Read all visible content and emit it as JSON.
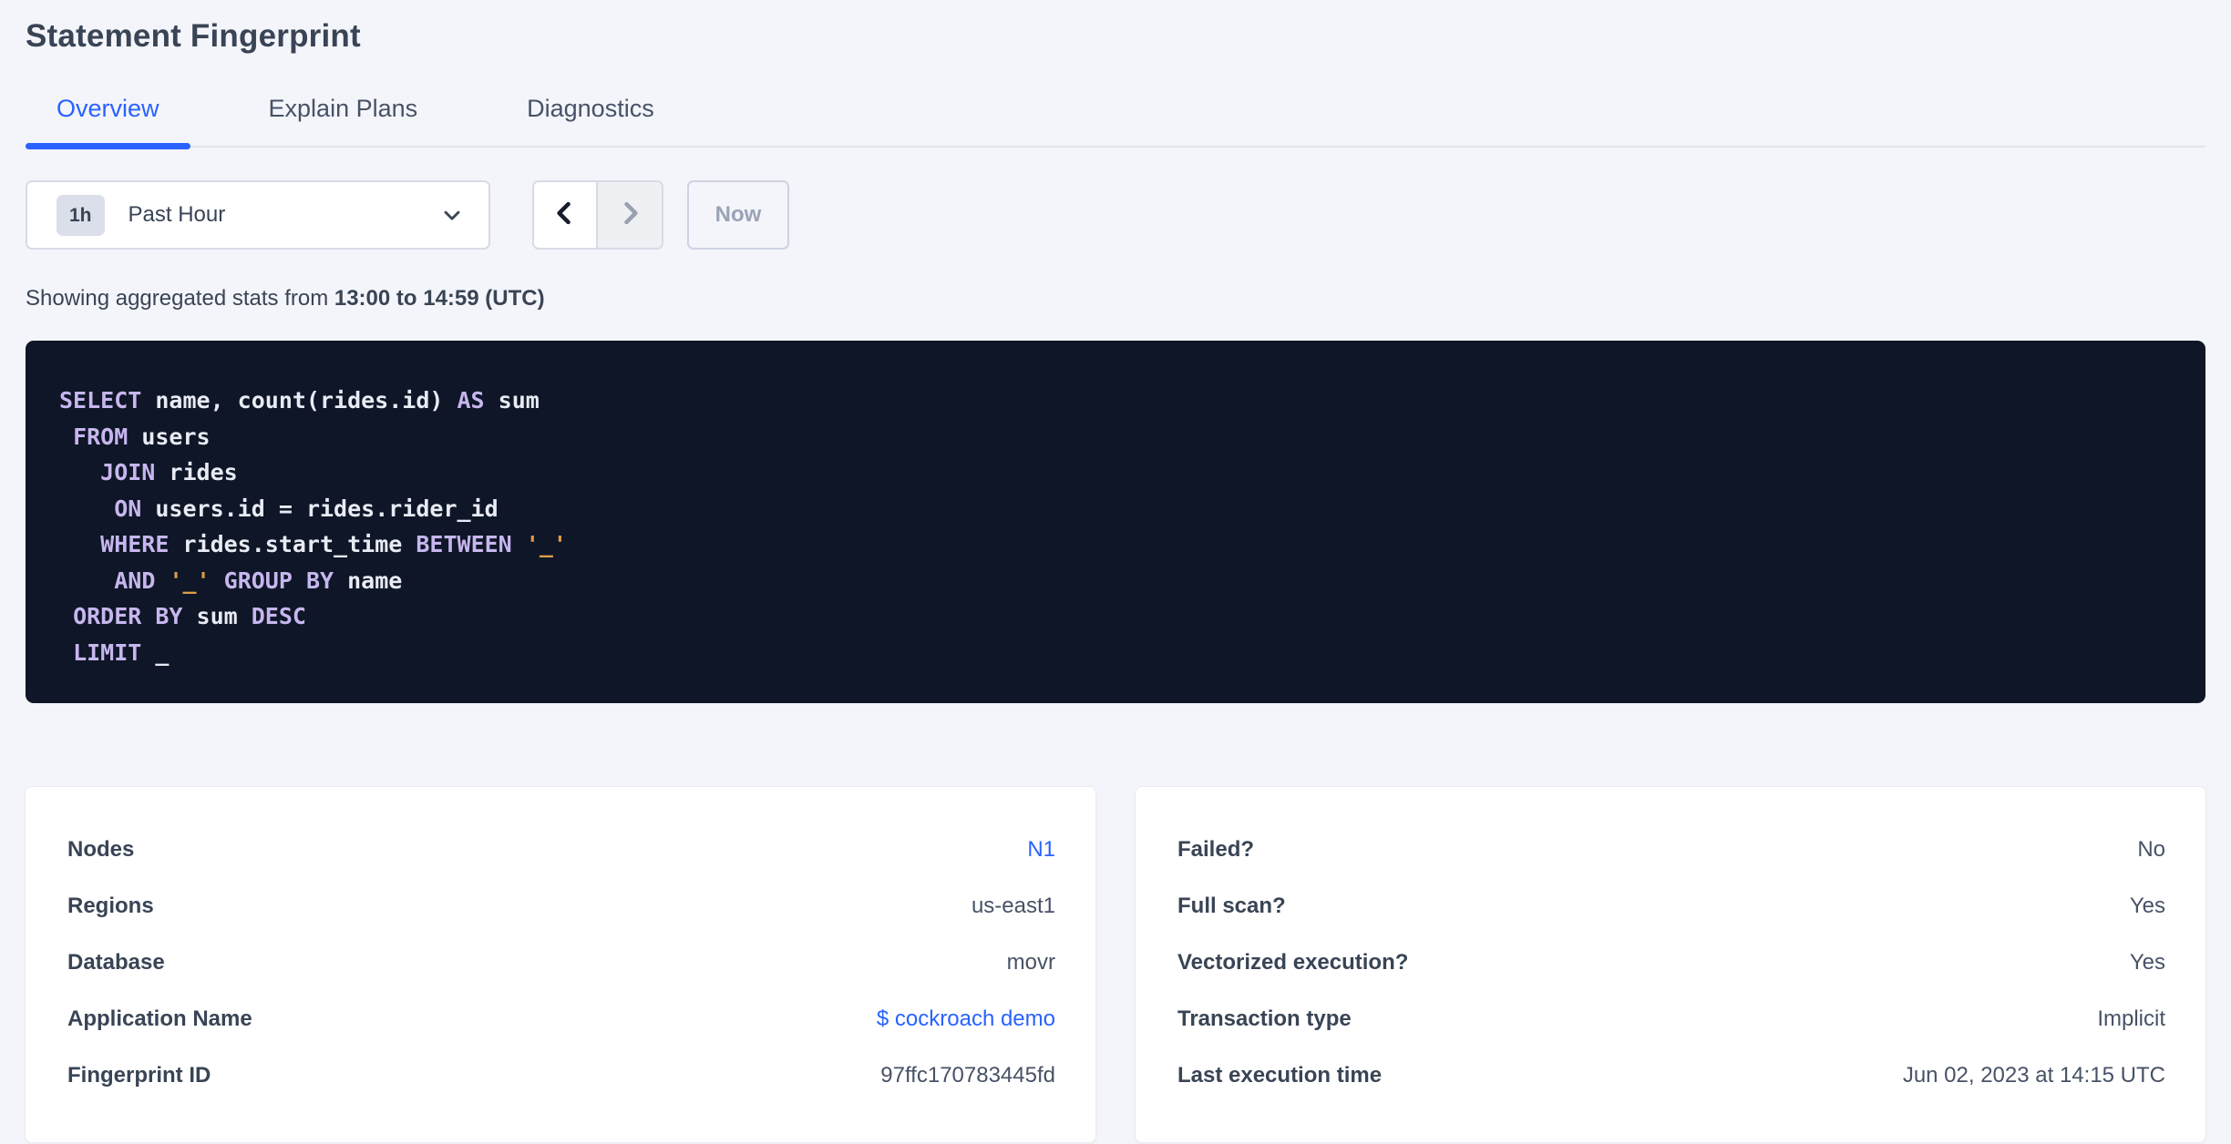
{
  "title": "Statement Fingerprint",
  "tabs": [
    {
      "label": "Overview",
      "active": true
    },
    {
      "label": "Explain Plans",
      "active": false
    },
    {
      "label": "Diagnostics",
      "active": false
    }
  ],
  "time_picker": {
    "badge": "1h",
    "selected": "Past Hour",
    "now_label": "Now",
    "icons": [
      "chevron-down-icon",
      "chevron-left-icon",
      "chevron-right-icon"
    ]
  },
  "stats_line": {
    "prefix": "Showing aggregated stats from ",
    "range": "13:00 to 14:59 (UTC)"
  },
  "sql": {
    "lines": [
      [
        [
          "kw",
          "SELECT"
        ],
        [
          "id",
          " name, count(rides.id) "
        ],
        [
          "kw",
          "AS"
        ],
        [
          "id",
          " sum"
        ]
      ],
      [
        [
          "id",
          " "
        ],
        [
          "kw",
          "FROM"
        ],
        [
          "id",
          " users"
        ]
      ],
      [
        [
          "id",
          "   "
        ],
        [
          "kw",
          "JOIN"
        ],
        [
          "id",
          " rides"
        ]
      ],
      [
        [
          "id",
          "    "
        ],
        [
          "kw",
          "ON"
        ],
        [
          "id",
          " users.id = rides.rider_id"
        ]
      ],
      [
        [
          "id",
          "   "
        ],
        [
          "kw",
          "WHERE"
        ],
        [
          "id",
          " rides.start_time "
        ],
        [
          "kw",
          "BETWEEN"
        ],
        [
          "id",
          " "
        ],
        [
          "str",
          "'_'"
        ]
      ],
      [
        [
          "id",
          "    "
        ],
        [
          "kw",
          "AND"
        ],
        [
          "id",
          " "
        ],
        [
          "str",
          "'_'"
        ],
        [
          "id",
          " "
        ],
        [
          "kw",
          "GROUP BY"
        ],
        [
          "id",
          " name"
        ]
      ],
      [
        [
          "id",
          " "
        ],
        [
          "kw",
          "ORDER BY"
        ],
        [
          "id",
          " sum "
        ],
        [
          "kw",
          "DESC"
        ]
      ],
      [
        [
          "id",
          " "
        ],
        [
          "kw",
          "LIMIT"
        ],
        [
          "id",
          " _"
        ]
      ]
    ]
  },
  "info_cards": [
    {
      "side": "left",
      "rows": [
        {
          "label": "Nodes",
          "value": "N1",
          "link": true
        },
        {
          "label": "Regions",
          "value": "us-east1",
          "link": false
        },
        {
          "label": "Database",
          "value": "movr",
          "link": false
        },
        {
          "label": "Application Name",
          "value": "$ cockroach demo",
          "link": true
        },
        {
          "label": "Fingerprint ID",
          "value": "97ffc170783445fd",
          "link": false
        }
      ]
    },
    {
      "side": "right",
      "rows": [
        {
          "label": "Failed?",
          "value": "No",
          "link": false
        },
        {
          "label": "Full scan?",
          "value": "Yes",
          "link": false
        },
        {
          "label": "Vectorized execution?",
          "value": "Yes",
          "link": false
        },
        {
          "label": "Transaction type",
          "value": "Implicit",
          "link": false
        },
        {
          "label": "Last execution time",
          "value": "Jun 02, 2023 at 14:15 UTC",
          "link": false
        }
      ]
    }
  ],
  "colors": {
    "accent_blue": "#2962ff",
    "sql_background": "#0e1627",
    "sql_keyword": "#c7b6ee",
    "sql_identifier": "#e9ebf4",
    "sql_literal": "#dd9c49"
  }
}
